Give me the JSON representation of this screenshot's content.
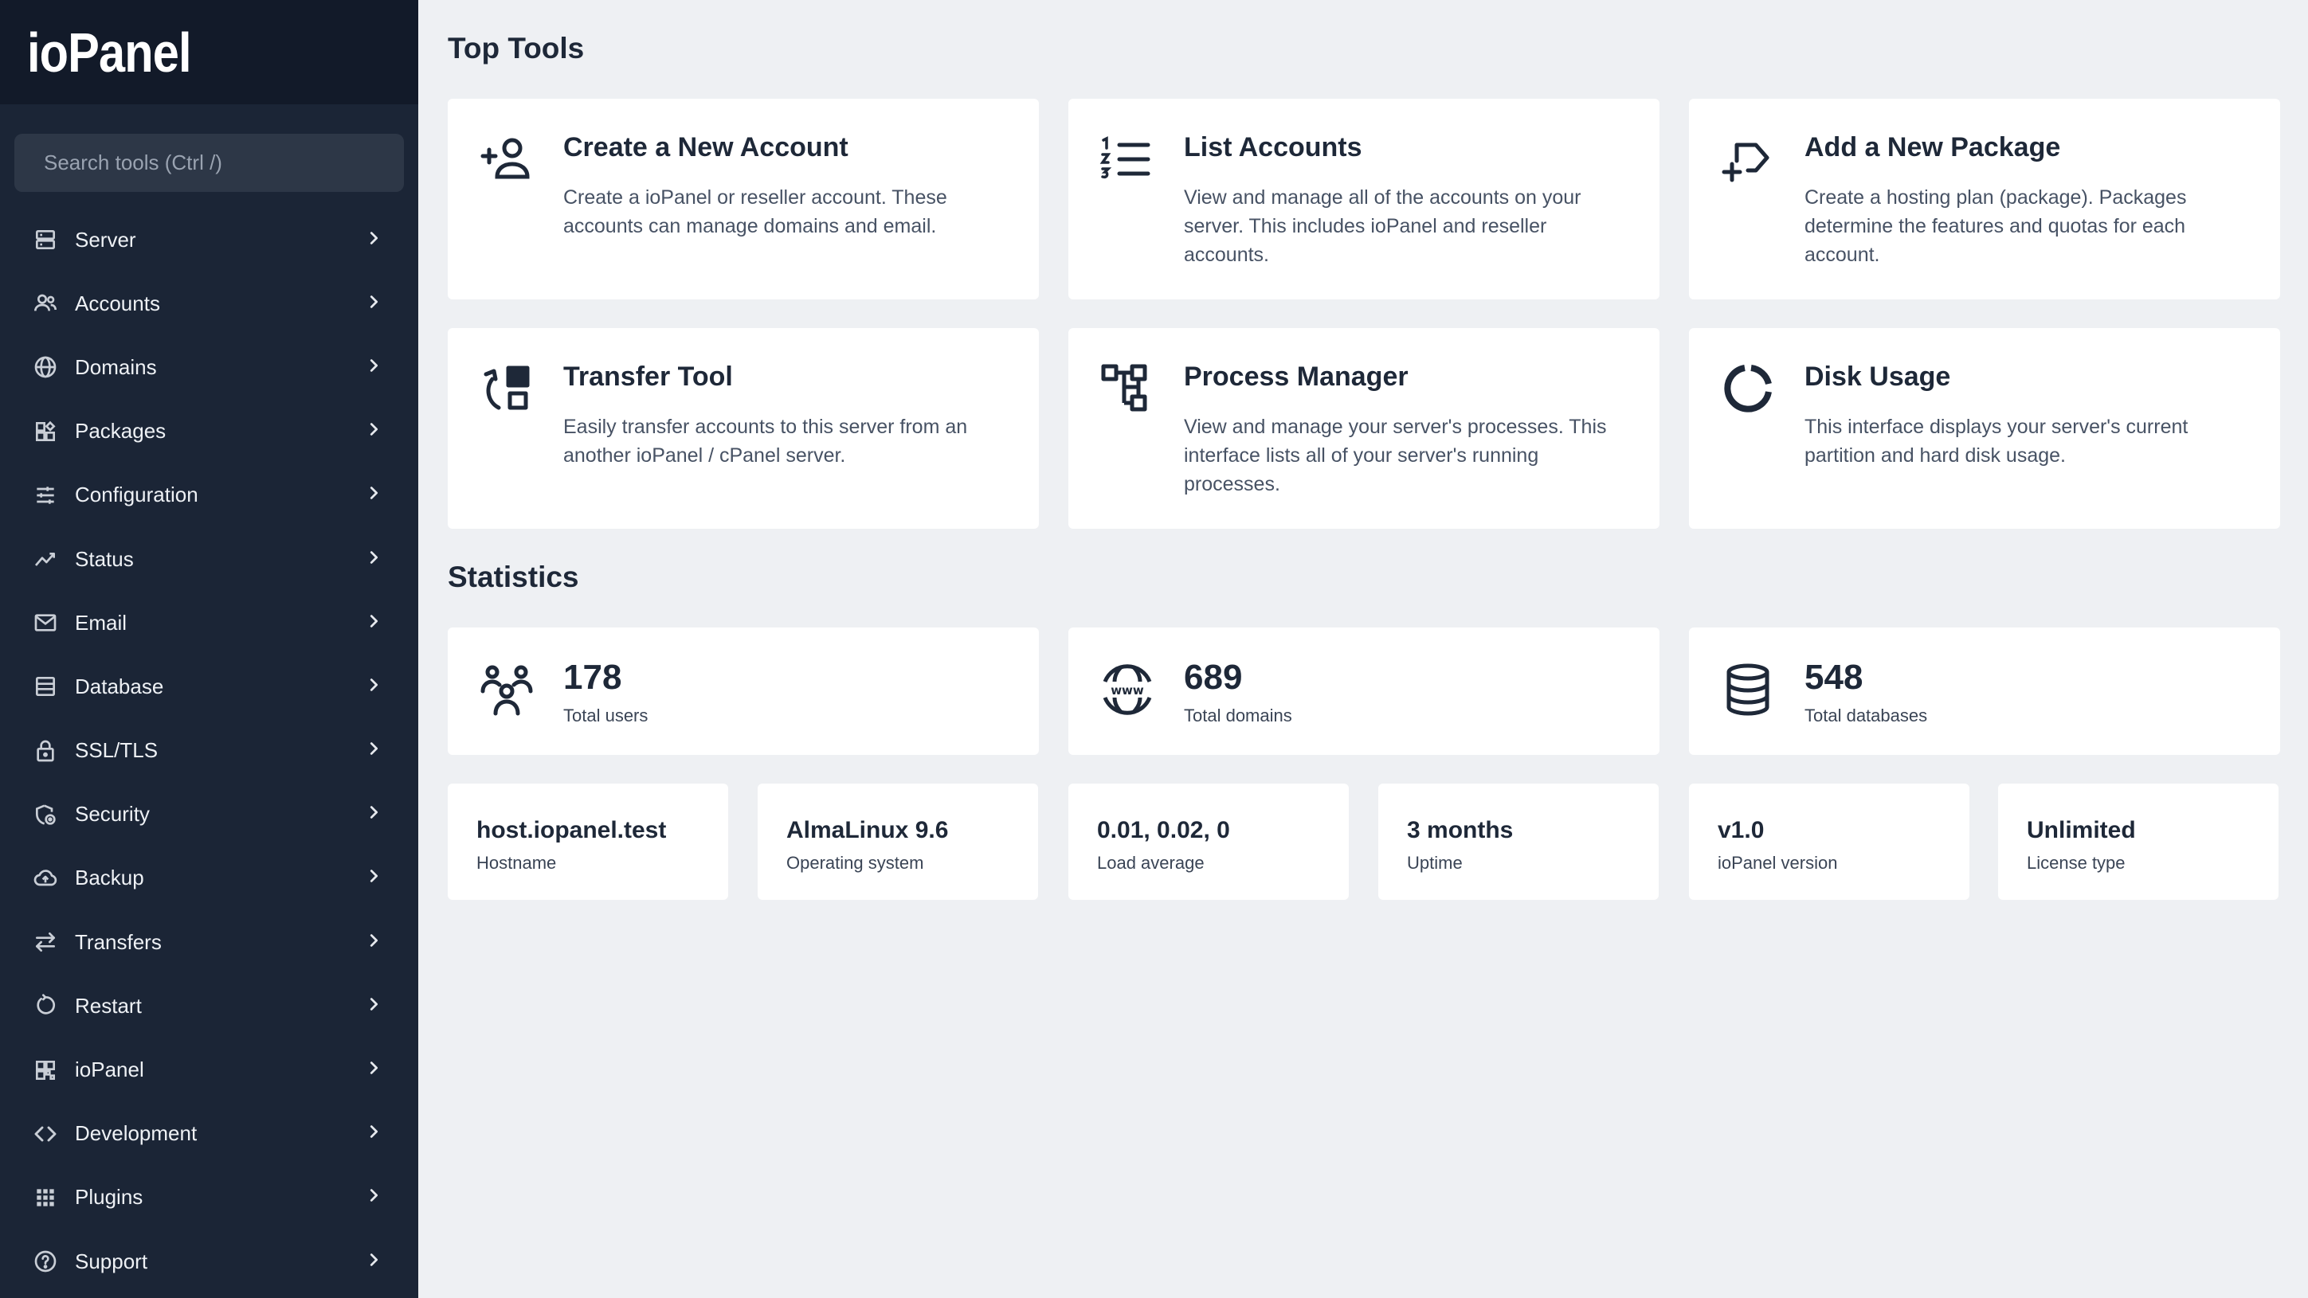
{
  "app": {
    "logo": "ioPanel"
  },
  "search": {
    "placeholder": "Search tools (Ctrl /)"
  },
  "sidebar": {
    "items": [
      {
        "label": "Server",
        "icon": "server-icon"
      },
      {
        "label": "Accounts",
        "icon": "users-icon"
      },
      {
        "label": "Domains",
        "icon": "globe-icon"
      },
      {
        "label": "Packages",
        "icon": "packages-icon"
      },
      {
        "label": "Configuration",
        "icon": "sliders-icon"
      },
      {
        "label": "Status",
        "icon": "chart-line-icon"
      },
      {
        "label": "Email",
        "icon": "mail-icon"
      },
      {
        "label": "Database",
        "icon": "database-icon"
      },
      {
        "label": "SSL/TLS",
        "icon": "lock-icon"
      },
      {
        "label": "Security",
        "icon": "shield-icon"
      },
      {
        "label": "Backup",
        "icon": "cloud-upload-icon"
      },
      {
        "label": "Transfers",
        "icon": "transfer-icon"
      },
      {
        "label": "Restart",
        "icon": "restart-icon"
      },
      {
        "label": "ioPanel",
        "icon": "dashboard-icon"
      },
      {
        "label": "Development",
        "icon": "code-icon"
      },
      {
        "label": "Plugins",
        "icon": "grid-icon"
      },
      {
        "label": "Support",
        "icon": "help-icon"
      }
    ]
  },
  "main": {
    "top_tools_title": "Top Tools",
    "statistics_title": "Statistics",
    "tools": [
      {
        "title": "Create a New Account",
        "desc": "Create a ioPanel or reseller account. These accounts can manage domains and email.",
        "icon": "user-plus-icon"
      },
      {
        "title": "List Accounts",
        "desc": "View and manage all of the accounts on your server. This includes ioPanel and reseller accounts.",
        "icon": "numbered-list-icon"
      },
      {
        "title": "Add a New Package",
        "desc": "Create a hosting plan (package). Packages determine the features and quotas for each account.",
        "icon": "tag-plus-icon"
      },
      {
        "title": "Transfer Tool",
        "desc": "Easily transfer accounts to this server from an another ioPanel / cPanel server.",
        "icon": "transfer-tool-icon"
      },
      {
        "title": "Process Manager",
        "desc": "View and manage your server's processes. This interface lists all of your server's running processes.",
        "icon": "process-icon"
      },
      {
        "title": "Disk Usage",
        "desc": "This interface displays your server's current partition and hard disk usage.",
        "icon": "donut-chart-icon"
      }
    ],
    "stats": [
      {
        "value": "178",
        "label": "Total users",
        "icon": "users-group-icon"
      },
      {
        "value": "689",
        "label": "Total domains",
        "icon": "www-globe-icon"
      },
      {
        "value": "548",
        "label": "Total databases",
        "icon": "database-icon"
      }
    ],
    "info": [
      {
        "value": "host.iopanel.test",
        "label": "Hostname"
      },
      {
        "value": "AlmaLinux 9.6",
        "label": "Operating system"
      },
      {
        "value": "0.01, 0.02, 0",
        "label": "Load average"
      },
      {
        "value": "3 months",
        "label": "Uptime"
      },
      {
        "value": "v1.0",
        "label": "ioPanel version"
      },
      {
        "value": "Unlimited",
        "label": "License type"
      }
    ]
  }
}
